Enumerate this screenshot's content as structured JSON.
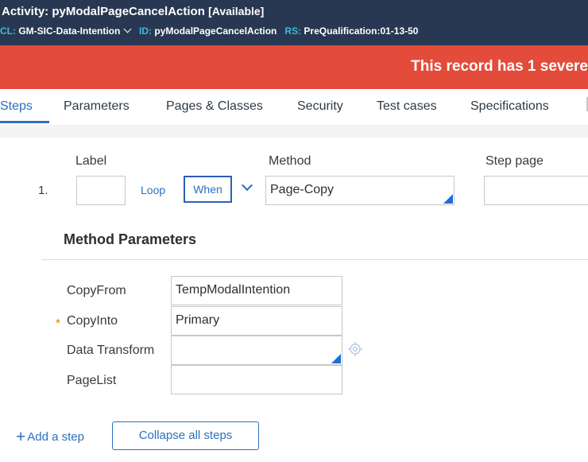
{
  "header": {
    "title": "Activity: pyModalPageCancelAction",
    "status": "[Available]",
    "class_label": "CL:",
    "class_value": "GM-SIC-Data-Intention",
    "id_label": "ID:",
    "id_value": "pyModalPageCancelAction",
    "rs_label": "RS:",
    "rs_value": "PreQualification:01-13-50"
  },
  "alert": {
    "text": "This record has 1 severe"
  },
  "tabs": [
    {
      "label": "Steps"
    },
    {
      "label": "Parameters"
    },
    {
      "label": "Pages & Classes"
    },
    {
      "label": "Security"
    },
    {
      "label": "Test cases"
    },
    {
      "label": "Specifications"
    }
  ],
  "step": {
    "number": "1.",
    "label_header": "Label",
    "method_header": "Method",
    "step_page_header": "Step page",
    "label_value": "",
    "loop_text": "Loop",
    "when_text": "When",
    "method_value": "Page-Copy",
    "step_page_value": ""
  },
  "method_parameters": {
    "title": "Method Parameters",
    "params": [
      {
        "name": "CopyFrom",
        "value": "TempModalIntention",
        "required": false
      },
      {
        "name": "CopyInto",
        "value": "Primary",
        "required": true
      },
      {
        "name": "Data Transform",
        "value": "",
        "required": false
      },
      {
        "name": "PageList",
        "value": "",
        "required": false
      }
    ],
    "required_marker": "*"
  },
  "footer": {
    "add_step": "Add a step",
    "add_icon": "+",
    "collapse_all": "Collapse all steps"
  },
  "colors": {
    "header_bg": "#283852",
    "alert_bg": "#e34b3b",
    "accent": "#2c6fbf",
    "meta_key": "#3fb8d8"
  }
}
